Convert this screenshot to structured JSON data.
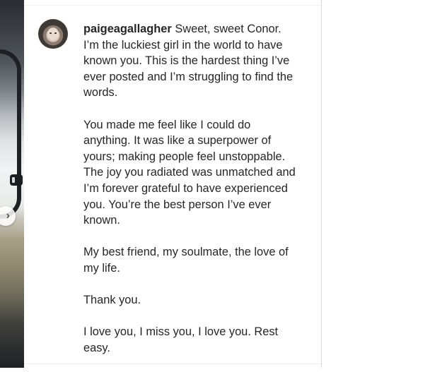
{
  "comment": {
    "username": "paigeagallagher",
    "paragraphs": [
      "Sweet, sweet Conor. I’m the luckiest girl in the world to have known you. This is the hardest thing I’ve ever posted and I’m struggling to find the words.",
      "You made me feel like I could do anything. It was like a superpower of yours; making people feel unstoppable. The joy you radiated was unmatched and I’m forever grateful to have experienced you. You’re the best person I’ve ever known.",
      "My best friend, my soulmate, the love of my life.",
      "Thank you.",
      "I love you, I miss you, I love you. Rest easy."
    ]
  },
  "carousel": {
    "next_icon": "chevron-right-icon",
    "glyph": "›"
  }
}
